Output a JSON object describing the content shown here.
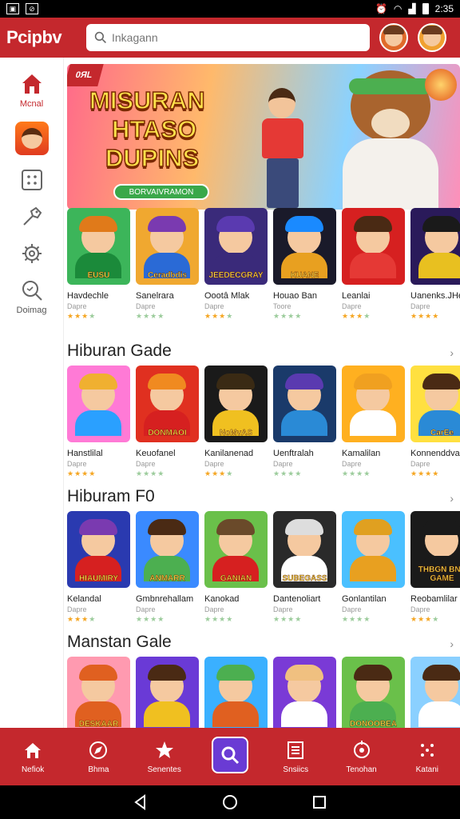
{
  "status": {
    "time": "2:35"
  },
  "app": {
    "logo": "Pcipbv",
    "search_placeholder": "Inkagann"
  },
  "sidebar": {
    "items": [
      {
        "label": "Mcnal",
        "icon": "home-icon"
      },
      {
        "label": "",
        "icon": "game-thumbnail"
      },
      {
        "label": "",
        "icon": "grid-icon"
      },
      {
        "label": "",
        "icon": "tag-icon"
      },
      {
        "label": "",
        "icon": "settings-icon"
      },
      {
        "label": "Doimag",
        "icon": "search-icon"
      }
    ]
  },
  "banner": {
    "badge": "0ЯL",
    "title_lines": [
      "MISURAN",
      "HTASO",
      "DUPINS"
    ],
    "button_text": "BORVAIVRAMON"
  },
  "rows": [
    {
      "section": "",
      "cards": [
        {
          "name": "Havdechle",
          "sub": "Dapre",
          "rating": 3,
          "title": "EUSU",
          "bg": "#3cb55a",
          "hair": "#e07a1a",
          "shirt": "#1b8a3a"
        },
        {
          "name": "Sanelrara",
          "sub": "Dapre",
          "rating": 0,
          "title": "Ceradbdis",
          "bg": "#f0a830",
          "hair": "#7a3ab0",
          "shirt": "#2a6ad6"
        },
        {
          "name": "Oootâ Mlak",
          "sub": "Dapre",
          "rating": 3,
          "title": "JEEDECGRAY",
          "bg": "#3a2a7a",
          "hair": "#5a3ab0",
          "shirt": "#3a2a7a"
        },
        {
          "name": "Houao Ban",
          "sub": "Toore",
          "rating": 0,
          "title": "KUANE",
          "bg": "#1a1a2a",
          "hair": "#1a8aff",
          "shirt": "#e8a020"
        },
        {
          "name": "Leanlai",
          "sub": "Dapre",
          "rating": 3,
          "title": "",
          "bg": "#d62020",
          "hair": "#4a2a14",
          "shirt": "#e53935"
        },
        {
          "name": "Uanenks.JHe",
          "sub": "Dapre",
          "rating": 4,
          "title": "",
          "bg": "#2a1a5a",
          "hair": "#1a1a1a",
          "shirt": "#e8c020"
        }
      ],
      "rating_suffix": {
        "4": "0"
      }
    },
    {
      "section": "Hiburan Gade",
      "cards": [
        {
          "name": "Hanstlilal",
          "sub": "Dapre",
          "rating": 4,
          "title": "",
          "bg": "#ff7ad6",
          "hair": "#f0b030",
          "shirt": "#2aa0ff"
        },
        {
          "name": "Keuofanel",
          "sub": "Dapre",
          "rating": 0,
          "title": "DONMAOI",
          "bg": "#e03020",
          "hair": "#f08a20",
          "shirt": "#d62020"
        },
        {
          "name": "Kanilanenad",
          "sub": "Dapre",
          "rating": 3,
          "title": "NoMvAS",
          "bg": "#1a1a1a",
          "hair": "#3a2a14",
          "shirt": "#f0c020"
        },
        {
          "name": "Uenftralah",
          "sub": "Dapre",
          "rating": 0,
          "title": "",
          "bg": "#1a3a6a",
          "hair": "#5a3ab0",
          "shirt": "#2a8ad6"
        },
        {
          "name": "Kamalilan",
          "sub": "Dapre",
          "rating": 0,
          "title": "",
          "bg": "#ffb020",
          "hair": "#f0a020",
          "shirt": "#fff"
        },
        {
          "name": "Konnenddvar",
          "sub": "Dapre",
          "rating": 4,
          "title": "CarEe",
          "bg": "#ffe040",
          "hair": "#4a2a14",
          "shirt": "#2a8ad6"
        }
      ]
    },
    {
      "section": "Hiburam F0",
      "cards": [
        {
          "name": "Kelandal",
          "sub": "Dapre",
          "rating": 3,
          "title": "HIAUMIRY",
          "bg": "#2a3ab0",
          "hair": "#7a3ab0",
          "shirt": "#d62020"
        },
        {
          "name": "Gmbnrehallam",
          "sub": "Dapre",
          "rating": 0,
          "title": "ANMARR",
          "bg": "#3a8aff",
          "hair": "#4a2a14",
          "shirt": "#4caf50"
        },
        {
          "name": "Kanokad",
          "sub": "Dapre",
          "rating": 0,
          "title": "GANIAN",
          "bg": "#6ac04a",
          "hair": "#6a4a2a",
          "shirt": "#d62020"
        },
        {
          "name": "Dantenoliart",
          "sub": "Dapre",
          "rating": 0,
          "title": "SUBEGASS",
          "bg": "#2a2a2a",
          "hair": "#ddd",
          "shirt": "#fff"
        },
        {
          "name": "Gonlantilan",
          "sub": "Dapre",
          "rating": 0,
          "title": "",
          "bg": "#4ac0ff",
          "hair": "#e0a020",
          "shirt": "#e8a020"
        },
        {
          "name": "Reobamlilar",
          "sub": "Dapre",
          "rating": 3,
          "title": "THBGN BNE GAME",
          "bg": "#1a1a1a",
          "hair": "#1a1a1a",
          "shirt": "#1a1a1a"
        }
      ]
    },
    {
      "section": "Manstan Gale",
      "cards": [
        {
          "name": "",
          "sub": "",
          "rating": 0,
          "title": "DESKAAR",
          "bg": "#ff9ab0",
          "hair": "#e06020",
          "shirt": "#e06020"
        },
        {
          "name": "",
          "sub": "",
          "rating": 0,
          "title": "",
          "bg": "#6a3ad6",
          "hair": "#4a2a14",
          "shirt": "#f0c020"
        },
        {
          "name": "",
          "sub": "",
          "rating": 0,
          "title": "",
          "bg": "#3ab0ff",
          "hair": "#4caf50",
          "shirt": "#e06020"
        },
        {
          "name": "",
          "sub": "",
          "rating": 0,
          "title": "",
          "bg": "#7a3ad6",
          "hair": "#f0c080",
          "shirt": "#fff"
        },
        {
          "name": "",
          "sub": "",
          "rating": 0,
          "title": "DONOOBEA",
          "bg": "#6ac04a",
          "hair": "#4a2a14",
          "shirt": "#4caf50"
        },
        {
          "name": "",
          "sub": "",
          "rating": 0,
          "title": "",
          "bg": "#8ad0ff",
          "hair": "#4a2a14",
          "shirt": "#fff"
        }
      ]
    }
  ],
  "bottom_tabs": [
    {
      "label": "Nefiok",
      "icon": "home-icon"
    },
    {
      "label": "Bhma",
      "icon": "compass-icon"
    },
    {
      "label": "Senentes",
      "icon": "star-icon"
    },
    {
      "label": "",
      "icon": "search-icon",
      "active": true
    },
    {
      "label": "Snsiics",
      "icon": "list-icon"
    },
    {
      "label": "Tenohan",
      "icon": "target-icon"
    },
    {
      "label": "Katani",
      "icon": "dots-icon"
    }
  ],
  "colors": {
    "brand": "#c4282d",
    "active_tab": "#6a3bd4",
    "star": "#f5a623"
  }
}
